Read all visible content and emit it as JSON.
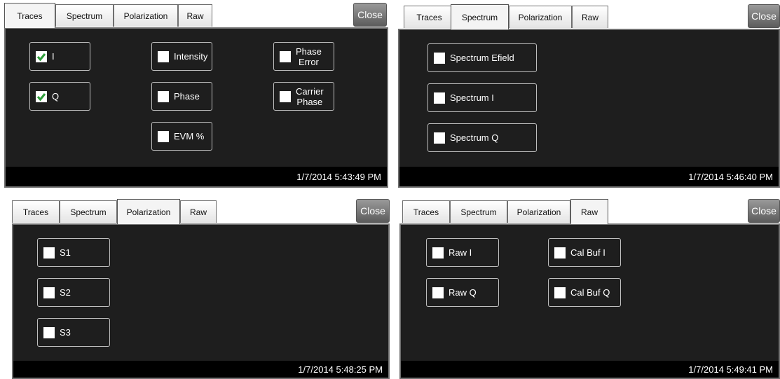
{
  "tabs": [
    "Traces",
    "Spectrum",
    "Polarization",
    "Raw"
  ],
  "close_label": "Close",
  "panels": [
    {
      "active_tab": "Traces",
      "timestamp": "1/7/2014 5:43:49 PM",
      "checkboxes": [
        {
          "label": "I",
          "checked": true
        },
        {
          "label": "Q",
          "checked": true
        },
        {
          "label": "Intensity",
          "checked": false
        },
        {
          "label": "Phase",
          "checked": false
        },
        {
          "label": "EVM %",
          "checked": false
        },
        {
          "label": "Phase\nError",
          "checked": false
        },
        {
          "label": "Carrier\nPhase",
          "checked": false
        }
      ]
    },
    {
      "active_tab": "Spectrum",
      "timestamp": "1/7/2014 5:46:40 PM",
      "checkboxes": [
        {
          "label": "Spectrum Efield",
          "checked": false
        },
        {
          "label": "Spectrum I",
          "checked": false
        },
        {
          "label": "Spectrum Q",
          "checked": false
        }
      ]
    },
    {
      "active_tab": "Polarization",
      "timestamp": "1/7/2014 5:48:25 PM",
      "checkboxes": [
        {
          "label": "S1",
          "checked": false
        },
        {
          "label": "S2",
          "checked": false
        },
        {
          "label": "S3",
          "checked": false
        }
      ]
    },
    {
      "active_tab": "Raw",
      "timestamp": "1/7/2014 5:49:41 PM",
      "checkboxes": [
        {
          "label": "Raw I",
          "checked": false
        },
        {
          "label": "Raw Q",
          "checked": false
        },
        {
          "label": "Cal Buf I",
          "checked": false
        },
        {
          "label": "Cal Buf Q",
          "checked": false
        }
      ]
    }
  ],
  "colors": {
    "check": "#2e9e3a",
    "panel_bg": "#1e1e1e",
    "status_bg": "#000000"
  }
}
